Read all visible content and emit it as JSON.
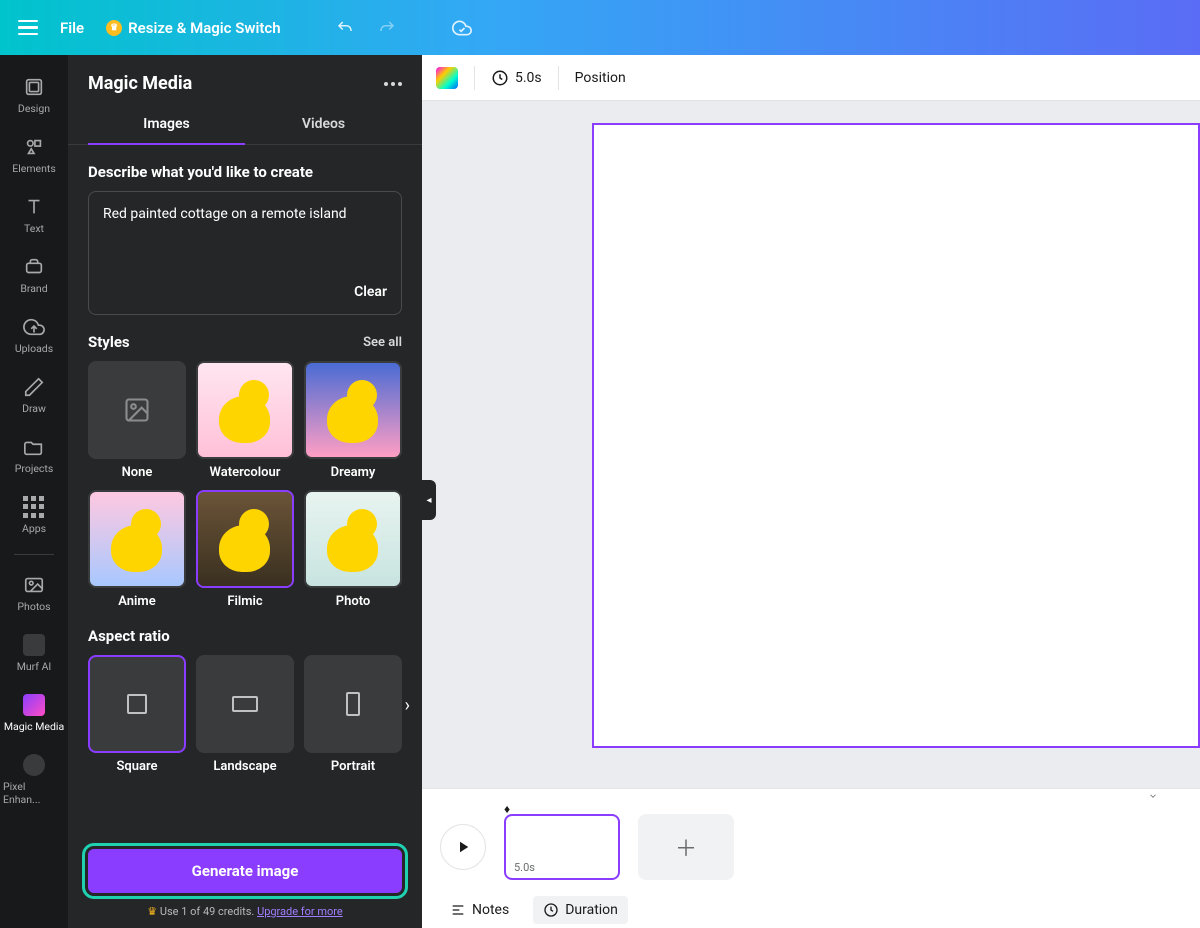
{
  "topbar": {
    "file": "File",
    "resize": "Resize & Magic Switch"
  },
  "leftnav": {
    "items": [
      "Design",
      "Elements",
      "Text",
      "Brand",
      "Uploads",
      "Draw",
      "Projects",
      "Apps"
    ],
    "extra": [
      "Photos",
      "Murf AI",
      "Magic Media",
      "Pixel Enhan..."
    ]
  },
  "panel": {
    "title": "Magic Media",
    "tabs": {
      "images": "Images",
      "videos": "Videos"
    },
    "describe_label": "Describe what you'd like to create",
    "prompt": "Red painted cottage on a remote island",
    "clear": "Clear",
    "styles_label": "Styles",
    "see_all": "See all",
    "styles": [
      "None",
      "Watercolour",
      "Dreamy",
      "Anime",
      "Filmic",
      "Photo"
    ],
    "aspect_label": "Aspect ratio",
    "ratios": [
      "Square",
      "Landscape",
      "Portrait"
    ],
    "generate": "Generate image",
    "credits_pre": "Use 1 of 49 credits.",
    "credits_link": "Upgrade for more"
  },
  "toolbar": {
    "duration": "5.0s",
    "position": "Position"
  },
  "timeline": {
    "clip_duration": "5.0s",
    "notes": "Notes",
    "duration_btn": "Duration"
  }
}
